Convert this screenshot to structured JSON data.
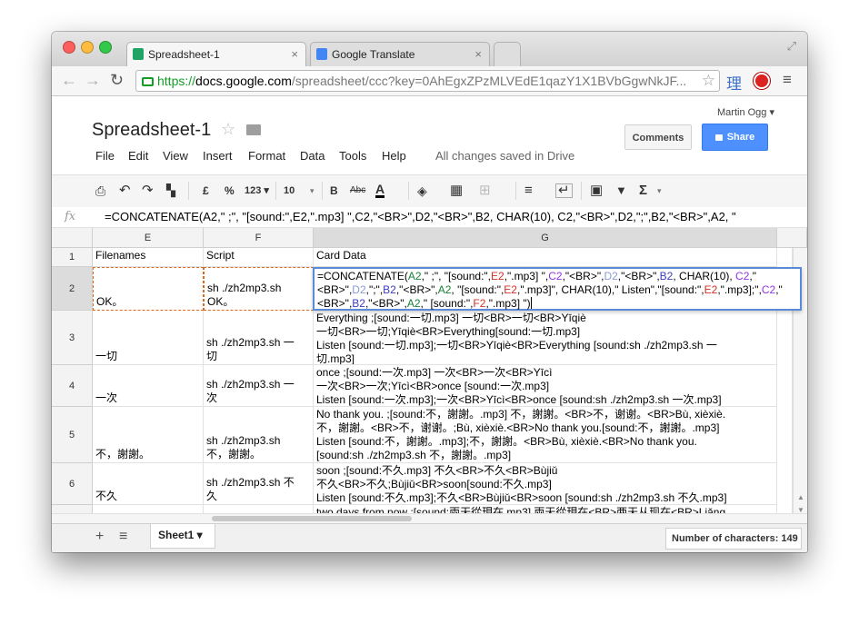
{
  "browser": {
    "tabs": [
      {
        "label": "Spreadsheet-1",
        "close": "×",
        "favicon_color": "#1fa463"
      },
      {
        "label": "Google Translate",
        "close": "×",
        "favicon_color": "#4285f4"
      }
    ],
    "url_scheme": "https://",
    "url_host": "docs.google.com",
    "url_path": "/spreadsheet/ccc?key=0AhEgxZPzMLVEdE1qazY1X1BVbGgwNkJF...",
    "ext_glyph": "理",
    "back": "←",
    "forward": "→",
    "reload": "↻"
  },
  "docs": {
    "title": "Spreadsheet-1",
    "user": "Martin Ogg ▾",
    "menu": [
      "File",
      "Edit",
      "View",
      "Insert",
      "Format",
      "Data",
      "Tools",
      "Help"
    ],
    "save_status": "All changes saved in Drive",
    "comments_label": "Comments",
    "share_label": "Share"
  },
  "toolbar": {
    "currency": "£",
    "percent": "%",
    "number_format": "123 ▾",
    "font_size": "10",
    "bold": "B",
    "strike": "Abc",
    "text_color": "A"
  },
  "formula_bar": {
    "fx_label": "fx",
    "content": "=CONCATENATE(A2,\" ;\", \"[sound:\",E2,\".mp3] \",C2,\"<BR>\",D2,\"<BR>\",B2, CHAR(10), C2,\"<BR>\",D2,\";\",B2,\"<BR>\",A2, \""
  },
  "grid": {
    "columns": [
      "E",
      "F",
      "G"
    ],
    "headers": {
      "E": "Filenames",
      "F": "Script",
      "G": "Card Data"
    },
    "rows": [
      {
        "num": "1"
      },
      {
        "num": "2",
        "E": "OK。",
        "F1": "sh ./zh2mp3.sh",
        "F2": "OK。"
      },
      {
        "num": "3",
        "E": "一切",
        "F1": "sh ./zh2mp3.sh 一",
        "F2": "切",
        "G": "Everything ;[sound:一切.mp3] 一切<BR>一切<BR>Yīqiè\n一切<BR>一切;Yīqiè<BR>Everything[sound:一切.mp3]\nListen [sound:一切.mp3];一切<BR>Yīqiè<BR>Everything [sound:sh ./zh2mp3.sh 一\n切.mp3]"
      },
      {
        "num": "4",
        "E": "一次",
        "F1": "sh ./zh2mp3.sh 一",
        "F2": "次",
        "G": "once ;[sound:一次.mp3] 一次<BR>一次<BR>Yīcì\n一次<BR>一次;Yīcì<BR>once [sound:一次.mp3]\nListen [sound:一次.mp3];一次<BR>Yīcì<BR>once [sound:sh ./zh2mp3.sh 一次.mp3]"
      },
      {
        "num": "5",
        "E": "不，謝謝。",
        "F1": "sh ./zh2mp3.sh",
        "F2": "不，謝謝。",
        "G": "No thank you. ;[sound:不，謝謝。.mp3] 不，謝謝。<BR>不，谢谢。<BR>Bù, xièxiè.\n不，謝謝。<BR>不，谢谢。;Bù, xièxiè.<BR>No thank you.[sound:不，謝謝。.mp3]\nListen [sound:不，謝謝。.mp3];不，謝謝。<BR>Bù, xièxiè.<BR>No thank you.\n[sound:sh ./zh2mp3.sh 不，謝謝。.mp3]"
      },
      {
        "num": "6",
        "E": "不久",
        "F1": "sh ./zh2mp3.sh 不",
        "F2": "久",
        "G": "soon ;[sound:不久.mp3] 不久<BR>不久<BR>Bùjiǔ\n不久<BR>不久;Bùjiǔ<BR>soon[sound:不久.mp3]\nListen [sound:不久.mp3];不久<BR>Bùjiǔ<BR>soon [sound:sh ./zh2mp3.sh 不久.mp3]"
      },
      {
        "num": "",
        "G": "two days from now ;[sound:兩天從現在.mp3] 兩天從現在<BR>两天从现在<BR>Liǎng"
      }
    ],
    "editor_segments": [
      {
        "t": "=CONCATENATE(",
        "c": "#000000"
      },
      {
        "t": "A2",
        "c": "#188038"
      },
      {
        "t": ",\" ;\", \"[sound:\",",
        "c": "#000000"
      },
      {
        "t": "E2",
        "c": "#d93025"
      },
      {
        "t": ",\".mp3] \",",
        "c": "#000000"
      },
      {
        "t": "C2",
        "c": "#9334e6"
      },
      {
        "t": ",\"<BR>\",",
        "c": "#000000"
      },
      {
        "t": "D2",
        "c": "#8a9bd1"
      },
      {
        "t": ",\"<BR>\",",
        "c": "#000000"
      },
      {
        "t": "B2",
        "c": "#3c3cc6"
      },
      {
        "t": ", CHAR(10), ",
        "c": "#000000"
      },
      {
        "t": "C2",
        "c": "#9334e6"
      },
      {
        "t": ",\"<BR>\",",
        "c": "#000000"
      },
      {
        "t": "D2",
        "c": "#8a9bd1"
      },
      {
        "t": ",\";\",",
        "c": "#000000"
      },
      {
        "t": "B2",
        "c": "#3c3cc6"
      },
      {
        "t": ",\"<BR>\",",
        "c": "#000000"
      },
      {
        "t": "A2",
        "c": "#188038"
      },
      {
        "t": ", \"[sound:\",",
        "c": "#000000"
      },
      {
        "t": "E2",
        "c": "#d93025"
      },
      {
        "t": ",\".mp3]\", CHAR(10),\" Listen\",\"",
        "c": "#000000"
      },
      {
        "t": "[sound:\",",
        "c": "#000000"
      },
      {
        "t": "E2",
        "c": "#d93025"
      },
      {
        "t": ",\".mp3];\",",
        "c": "#000000"
      },
      {
        "t": "C2",
        "c": "#9334e6"
      },
      {
        "t": ",\"<BR>\",",
        "c": "#000000"
      },
      {
        "t": "B2",
        "c": "#3c3cc6"
      },
      {
        "t": ",\"<BR>\",",
        "c": "#000000"
      },
      {
        "t": "A2",
        "c": "#188038"
      },
      {
        "t": ",\" [sound:\",",
        "c": "#000000"
      },
      {
        "t": "F2",
        "c": "#d93025"
      },
      {
        "t": ",\".mp3] \")",
        "c": "#000000"
      }
    ]
  },
  "footer": {
    "add_sheet": "+",
    "sheet_list": "≡",
    "sheet_tab": "Sheet1 ▾",
    "char_count": "Number of characters: 149"
  },
  "colors": {
    "accent": "#4d90fe",
    "secure_green": "#129e25",
    "copy_border": "#e06a1c",
    "selection": "#5b8bd8"
  }
}
